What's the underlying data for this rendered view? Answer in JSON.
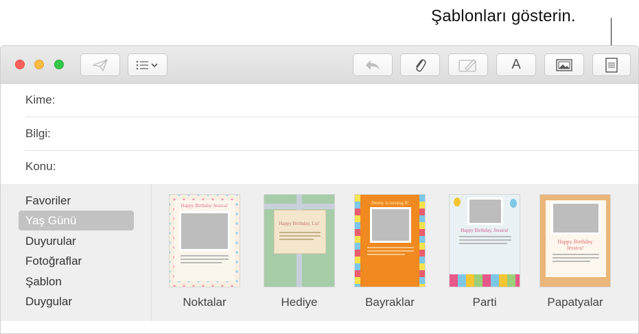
{
  "callout": {
    "text": "Şablonları gösterin."
  },
  "toolbar": {
    "font_button_glyph": "A",
    "icons": [
      "send-icon",
      "list-format-icon",
      "reply-icon",
      "attachment-icon",
      "markup-icon",
      "font-icon",
      "photo-browser-icon",
      "stationery-icon"
    ]
  },
  "fields": {
    "to_label": "Kime:",
    "cc_label": "Bilgi:",
    "subject_label": "Konu:"
  },
  "stationery": {
    "categories": [
      "Favoriler",
      "Yaş Günü",
      "Duyurular",
      "Fotoğraflar",
      "Şablon",
      "Duygular"
    ],
    "selected_category": "Yaş Günü",
    "templates": [
      "Noktalar",
      "Hediye",
      "Bayraklar",
      "Parti",
      "Papatyalar"
    ],
    "thumb_titles": {
      "noktalar": "Happy Birthday Jessica!",
      "hediye": "Happy Birthday, Liz!",
      "bayraklar": "Jimmy is turning 8!",
      "parti": "Happy Birthday, Jessica!",
      "papatyalar_line1": "Happy Birthday",
      "papatyalar_line2": "Jessica!"
    }
  },
  "colors": {
    "close": "#fc605c",
    "minimize": "#fdbc40",
    "zoom": "#34c84a",
    "selection": "#c2c2c2"
  }
}
